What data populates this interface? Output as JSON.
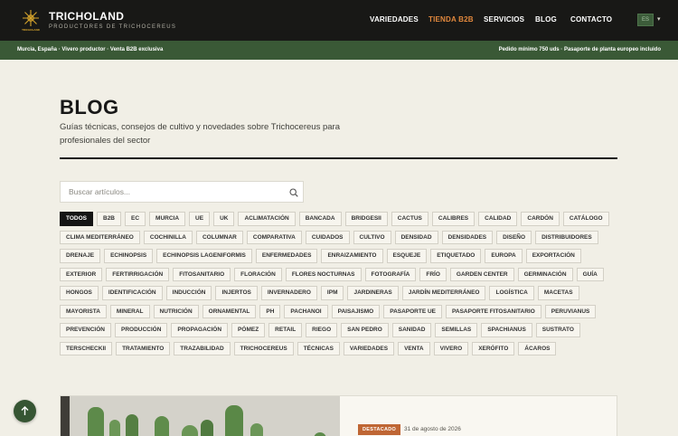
{
  "header": {
    "brand": "TRICHOLAND",
    "tagline": "PRODUCTORES DE TRICHOCEREUS",
    "logo_text": "TRICHOLAND",
    "nav": [
      "VARIEDADES",
      "TIENDA B2B",
      "SERVICIOS",
      "BLOG",
      "CONTACTO"
    ],
    "nav_active": "TIENDA B2B",
    "language": "ES",
    "accent_color": "#e2883d"
  },
  "info_strip": {
    "left": "Murcia, España · Vivero productor · Venta B2B exclusiva",
    "right": "Pedido mínimo 750 uds · Pasaporte de planta europeo incluido",
    "background": "#3a5936"
  },
  "page": {
    "title": "BLOG",
    "subtitle": "Guías técnicas, consejos de cultivo y novedades sobre Trichocereus para profesionales del sector"
  },
  "search": {
    "placeholder": "Buscar artículos...",
    "value": ""
  },
  "tags": [
    "TODOS",
    "B2B",
    "EC",
    "MURCIA",
    "UE",
    "UK",
    "ACLIMATACIÓN",
    "BANCADA",
    "BRIDGESII",
    "CACTUS",
    "CALIBRES",
    "CALIDAD",
    "CARDÓN",
    "CATÁLOGO",
    "CLIMA MEDITERRÁNEO",
    "COCHINILLA",
    "COLUMNAR",
    "COMPARATIVA",
    "CUIDADOS",
    "CULTIVO",
    "DENSIDAD",
    "DENSIDADES",
    "DISEÑO",
    "DISTRIBUIDORES",
    "DRENAJE",
    "ECHINOPSIS",
    "ECHINOPSIS LAGENIFORMIS",
    "ENFERMEDADES",
    "ENRAIZAMIENTO",
    "ESQUEJE",
    "ETIQUETADO",
    "EUROPA",
    "EXPORTACIÓN",
    "EXTERIOR",
    "FERTIRRIGACIÓN",
    "FITOSANITARIO",
    "FLORACIÓN",
    "FLORES NOCTURNAS",
    "FOTOGRAFÍA",
    "FRÍO",
    "GARDEN CENTER",
    "GERMINACIÓN",
    "GUÍA",
    "HONGOS",
    "IDENTIFICACIÓN",
    "INDUCCIÓN",
    "INJERTOS",
    "INVERNADERO",
    "IPM",
    "JARDINERAS",
    "JARDÍN MEDITERRÁNEO",
    "LOGÍSTICA",
    "MACETAS",
    "MAYORISTA",
    "MINERAL",
    "NUTRICIÓN",
    "ORNAMENTAL",
    "PH",
    "PACHANOI",
    "PAISAJISMO",
    "PASAPORTE UE",
    "PASAPORTE FITOSANITARIO",
    "PERUVIANUS",
    "PREVENCIÓN",
    "PRODUCCIÓN",
    "PROPAGACIÓN",
    "PÓMEZ",
    "RETAIL",
    "RIEGO",
    "SAN PEDRO",
    "SANIDAD",
    "SEMILLAS",
    "SPACHIANUS",
    "SUSTRATO",
    "TERSCHECKII",
    "TRATAMIENTO",
    "TRAZABILIDAD",
    "TRICHOCEREUS",
    "TÉCNICAS",
    "VARIEDADES",
    "VENTA",
    "VIVERO",
    "XERÓFITO",
    "ÁCAROS"
  ],
  "active_tag": "TODOS",
  "featured": {
    "badge": "DESTACADO",
    "date": "31 de agosto de 2026",
    "badge_color": "#bf6634"
  }
}
